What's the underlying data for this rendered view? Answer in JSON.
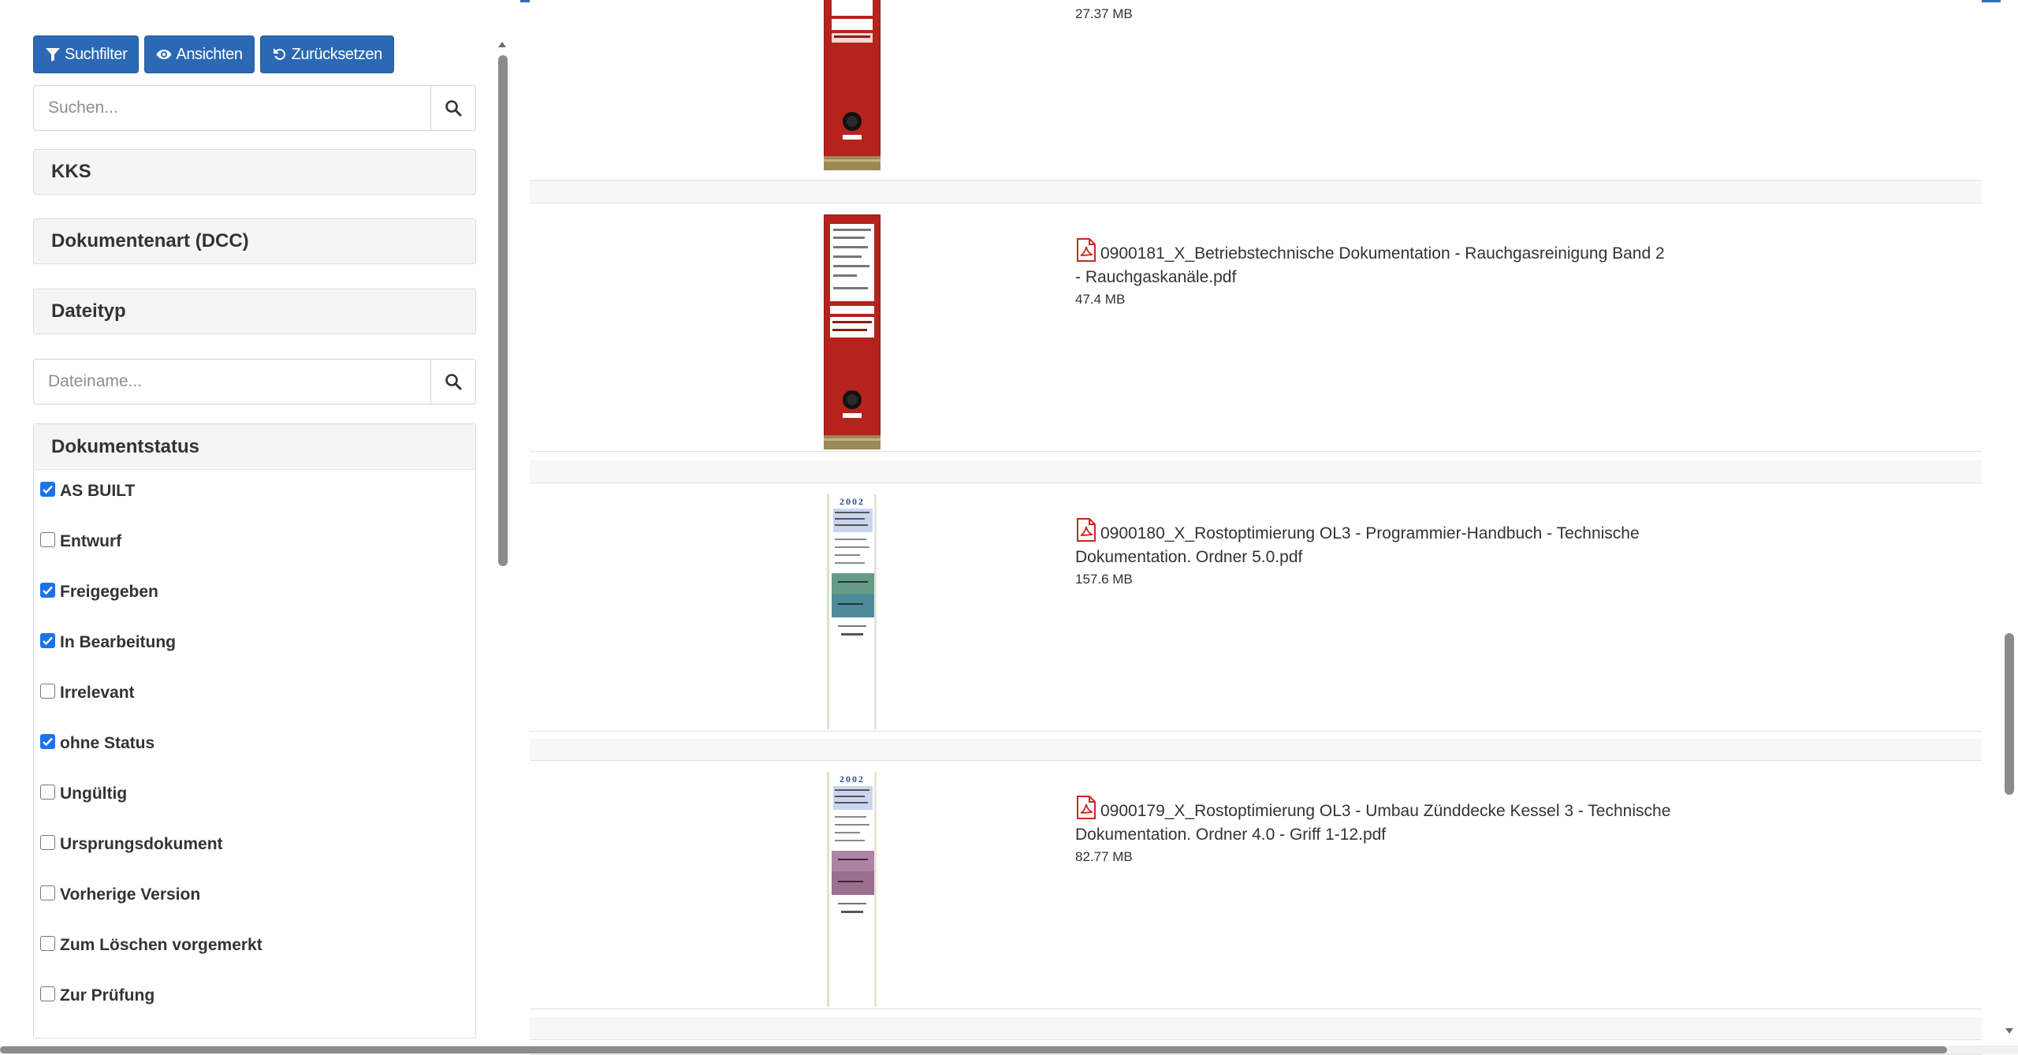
{
  "toolbar": {
    "filter_label": "Suchfilter",
    "views_label": "Ansichten",
    "reset_label": "Zurücksetzen"
  },
  "search": {
    "placeholder": "Suchen..."
  },
  "filename_search": {
    "placeholder": "Dateiname..."
  },
  "facets": {
    "kks": "KKS",
    "doc_type": "Dokumentenart (DCC)",
    "file_type": "Dateityp"
  },
  "status_filter": {
    "title": "Dokumentstatus",
    "items": [
      {
        "label": "AS BUILT",
        "checked": true
      },
      {
        "label": "Entwurf",
        "checked": false
      },
      {
        "label": "Freigegeben",
        "checked": true
      },
      {
        "label": "In Bearbeitung",
        "checked": true
      },
      {
        "label": "Irrelevant",
        "checked": false
      },
      {
        "label": "ohne Status",
        "checked": true
      },
      {
        "label": "Ungültig",
        "checked": false
      },
      {
        "label": "Ursprungsdokument",
        "checked": false
      },
      {
        "label": "Vorherige Version",
        "checked": false
      },
      {
        "label": "Zum Löschen vorgemerkt",
        "checked": false
      },
      {
        "label": "Zur Prüfung",
        "checked": false
      }
    ]
  },
  "documents": [
    {
      "title": "",
      "size": "27.37 MB",
      "thumb": "red-binder"
    },
    {
      "title": "0900181_X_Betriebstechnische Dokumentation - Rauchgasreinigung Band 2 - Rauchgaskanäle.pdf",
      "size": "47.4 MB",
      "thumb": "red-binder"
    },
    {
      "title": "0900180_X_Rostoptimierung OL3 - Programmier-Handbuch - Technische Dokumentation. Ordner 5.0.pdf",
      "size": "157.6 MB",
      "thumb": "white-binder-green"
    },
    {
      "title": "0900179_X_Rostoptimierung OL3 - Umbau Zünddecke Kessel 3 - Technische Dokumentation. Ordner 4.0 - Griff 1-12.pdf",
      "size": "82.77 MB",
      "thumb": "white-binder-purple"
    }
  ],
  "thumb_text": {
    "year": "2002"
  },
  "colors": {
    "primary": "#2b69b4",
    "binder_red": "#b5231c",
    "checkbox": "#1a73e8"
  }
}
